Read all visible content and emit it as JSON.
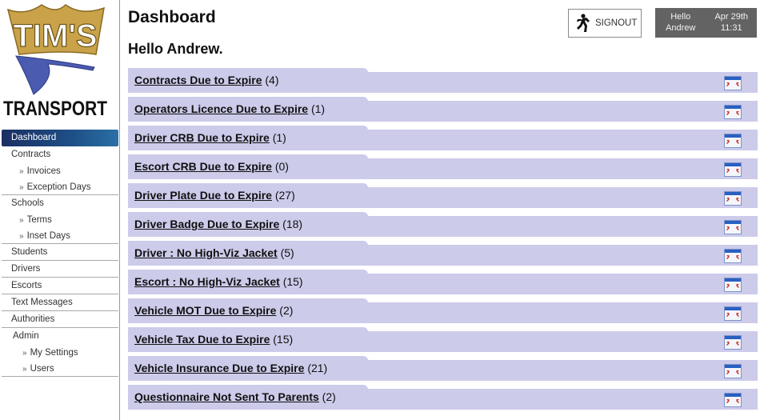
{
  "brand": {
    "logo_top": "TIM'S",
    "logo_bottom": "TRANSPORT"
  },
  "header": {
    "title": "Dashboard",
    "greeting": "Hello Andrew.",
    "signout_label": "SIGNOUT",
    "user_hello": "Hello",
    "user_name": "Andrew",
    "date": "Apr 29th",
    "time": "11:31"
  },
  "sidebar": {
    "items": [
      {
        "label": "Dashboard",
        "active": true
      },
      {
        "label": "Contracts"
      },
      {
        "label": "Invoices",
        "chevron": "»"
      },
      {
        "label": "Exception Days",
        "chevron": "»"
      },
      {
        "label": "Schools"
      },
      {
        "label": "Terms",
        "chevron": "»"
      },
      {
        "label": "Inset Days",
        "chevron": "»"
      },
      {
        "label": "Students"
      },
      {
        "label": "Drivers"
      },
      {
        "label": "Escorts"
      },
      {
        "label": "Text Messages"
      },
      {
        "label": "Authorities"
      },
      {
        "label": "Admin"
      },
      {
        "label": "My Settings",
        "chevron": "»"
      },
      {
        "label": "Users",
        "chevron": "»"
      }
    ]
  },
  "alerts": [
    {
      "label": "Contracts Due to Expire",
      "count": "(4)"
    },
    {
      "label": "Operators Licence Due to Expire",
      "count": "(1)"
    },
    {
      "label": "Driver CRB Due to Expire",
      "count": "(1)"
    },
    {
      "label": "Escort CRB Due to Expire",
      "count": "(0)"
    },
    {
      "label": "Driver Plate Due to Expire",
      "count": "(27)"
    },
    {
      "label": "Driver Badge Due to Expire",
      "count": "(18)"
    },
    {
      "label": "Driver : No High-Viz Jacket",
      "count": "(5)"
    },
    {
      "label": "Escort : No High-Viz Jacket",
      "count": "(15)"
    },
    {
      "label": "Vehicle MOT Due to Expire",
      "count": "(2)"
    },
    {
      "label": "Vehicle Tax Due to Expire",
      "count": "(15)"
    },
    {
      "label": "Vehicle Insurance Due to Expire",
      "count": "(21)"
    },
    {
      "label": "Questionnaire Not Sent To Parents",
      "count": "(2)"
    }
  ],
  "colors": {
    "alert_bg": "#cccbea",
    "active_nav": "#1e4f86",
    "userbox_bg": "#636363"
  }
}
